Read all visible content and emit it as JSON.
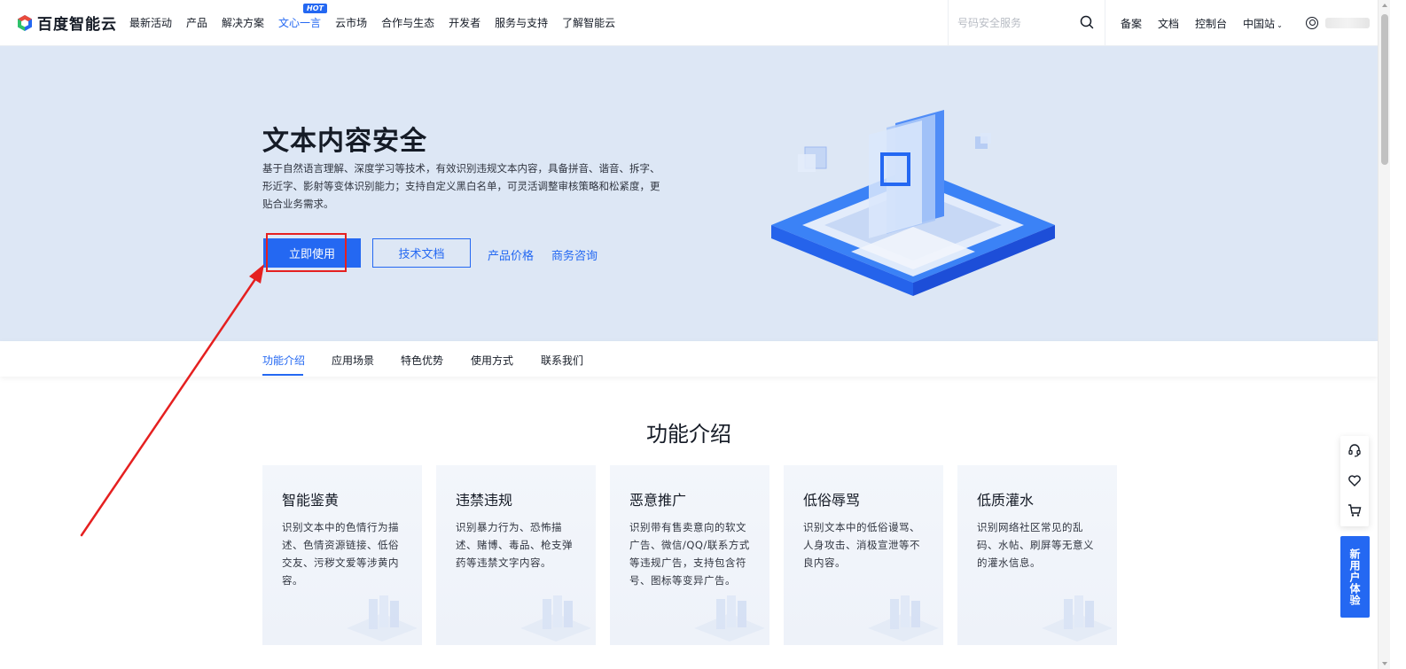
{
  "nav": {
    "brand": "百度智能云",
    "items": [
      {
        "label": "最新活动"
      },
      {
        "label": "产品"
      },
      {
        "label": "解决方案"
      },
      {
        "label": "文心一言",
        "badge": "HOT"
      },
      {
        "label": "云市场"
      },
      {
        "label": "合作与生态"
      },
      {
        "label": "开发者"
      },
      {
        "label": "服务与支持"
      },
      {
        "label": "了解智能云"
      }
    ],
    "search_placeholder": "号码安全服务",
    "right_links": [
      {
        "label": "备案"
      },
      {
        "label": "文档"
      },
      {
        "label": "控制台"
      },
      {
        "label": "中国站"
      }
    ]
  },
  "hero": {
    "title": "文本内容安全",
    "description": "基于自然语言理解、深度学习等技术，有效识别违规文本内容，具备拼音、谐音、拆字、形近字、影射等变体识别能力；支持自定义黑白名单，可灵活调整审核策略和松紧度，更贴合业务需求。",
    "primary_button": "立即使用",
    "outline_button": "技术文档",
    "link_price": "产品价格",
    "link_consult": "商务咨询"
  },
  "subtabs": [
    {
      "label": "功能介绍"
    },
    {
      "label": "应用场景"
    },
    {
      "label": "特色优势"
    },
    {
      "label": "使用方式"
    },
    {
      "label": "联系我们"
    }
  ],
  "section": {
    "title": "功能介绍",
    "cards": [
      {
        "title": "智能鉴黄",
        "desc": "识别文本中的色情行为描述、色情资源链接、低俗交友、污秽文爱等涉黄内容。"
      },
      {
        "title": "违禁违规",
        "desc": "识别暴力行为、恐怖描述、赌博、毒品、枪支弹药等违禁文字内容。"
      },
      {
        "title": "恶意推广",
        "desc": "识别带有售卖意向的软文广告、微信/QQ/联系方式等违规广告，支持包含符号、图标等变异广告。"
      },
      {
        "title": "低俗辱骂",
        "desc": "识别文本中的低俗谩骂、人身攻击、消极宣泄等不良内容。"
      },
      {
        "title": "低质灌水",
        "desc": "识别网络社区常见的乱码、水帖、刷屏等无意义的灌水信息。"
      }
    ]
  },
  "float": {
    "new_user": "新用户体验"
  },
  "colors": {
    "accent": "#2468f2",
    "hero_bg": "#dde7f5",
    "annotation": "#e52020"
  }
}
